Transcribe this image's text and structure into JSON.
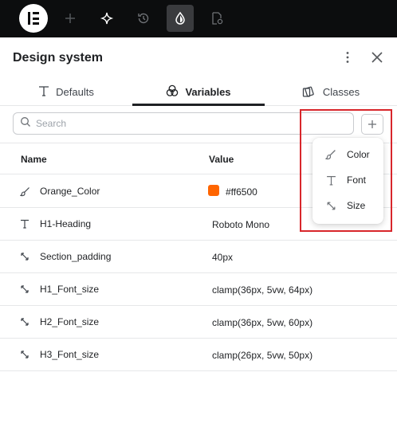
{
  "topbar": {
    "icons": [
      "elementor-logo",
      "plus-icon",
      "sparkle-icon",
      "history-icon",
      "droplet-icon",
      "page-settings-icon"
    ],
    "active_icon": "droplet-icon"
  },
  "header": {
    "title": "Design system",
    "icons": [
      "kebab-menu-icon",
      "close-icon"
    ]
  },
  "tabs": [
    {
      "label": "Defaults",
      "icon": "text-type-icon"
    },
    {
      "label": "Variables",
      "icon": "color-circles-icon",
      "active": true
    },
    {
      "label": "Classes",
      "icon": "classes-icon"
    }
  ],
  "search": {
    "placeholder": "Search",
    "value": "",
    "add_icon": "plus-icon"
  },
  "table": {
    "columns": [
      "Name",
      "Value"
    ],
    "rows": [
      {
        "icon": "color-brush-icon",
        "name": "Orange_Color",
        "value": "#ff6500",
        "swatch": "#ff6500"
      },
      {
        "icon": "font-icon",
        "name": "H1-Heading",
        "value": "Roboto Mono"
      },
      {
        "icon": "size-arrows-icon",
        "name": "Section_padding",
        "value": "40px"
      },
      {
        "icon": "size-arrows-icon",
        "name": "H1_Font_size",
        "value": "clamp(36px, 5vw, 64px)"
      },
      {
        "icon": "size-arrows-icon",
        "name": "H2_Font_size",
        "value": "clamp(36px, 5vw, 60px)"
      },
      {
        "icon": "size-arrows-icon",
        "name": "H3_Font_size",
        "value": "clamp(26px, 5vw, 50px)"
      }
    ]
  },
  "add_menu": {
    "items": [
      {
        "icon": "color-brush-icon",
        "label": "Color"
      },
      {
        "icon": "font-icon",
        "label": "Font"
      },
      {
        "icon": "size-arrows-icon",
        "label": "Size"
      }
    ]
  },
  "colors": {
    "topbar_bg": "#0c0d0e",
    "highlight": "#d8262b",
    "accent_swatch": "#ff6500"
  }
}
